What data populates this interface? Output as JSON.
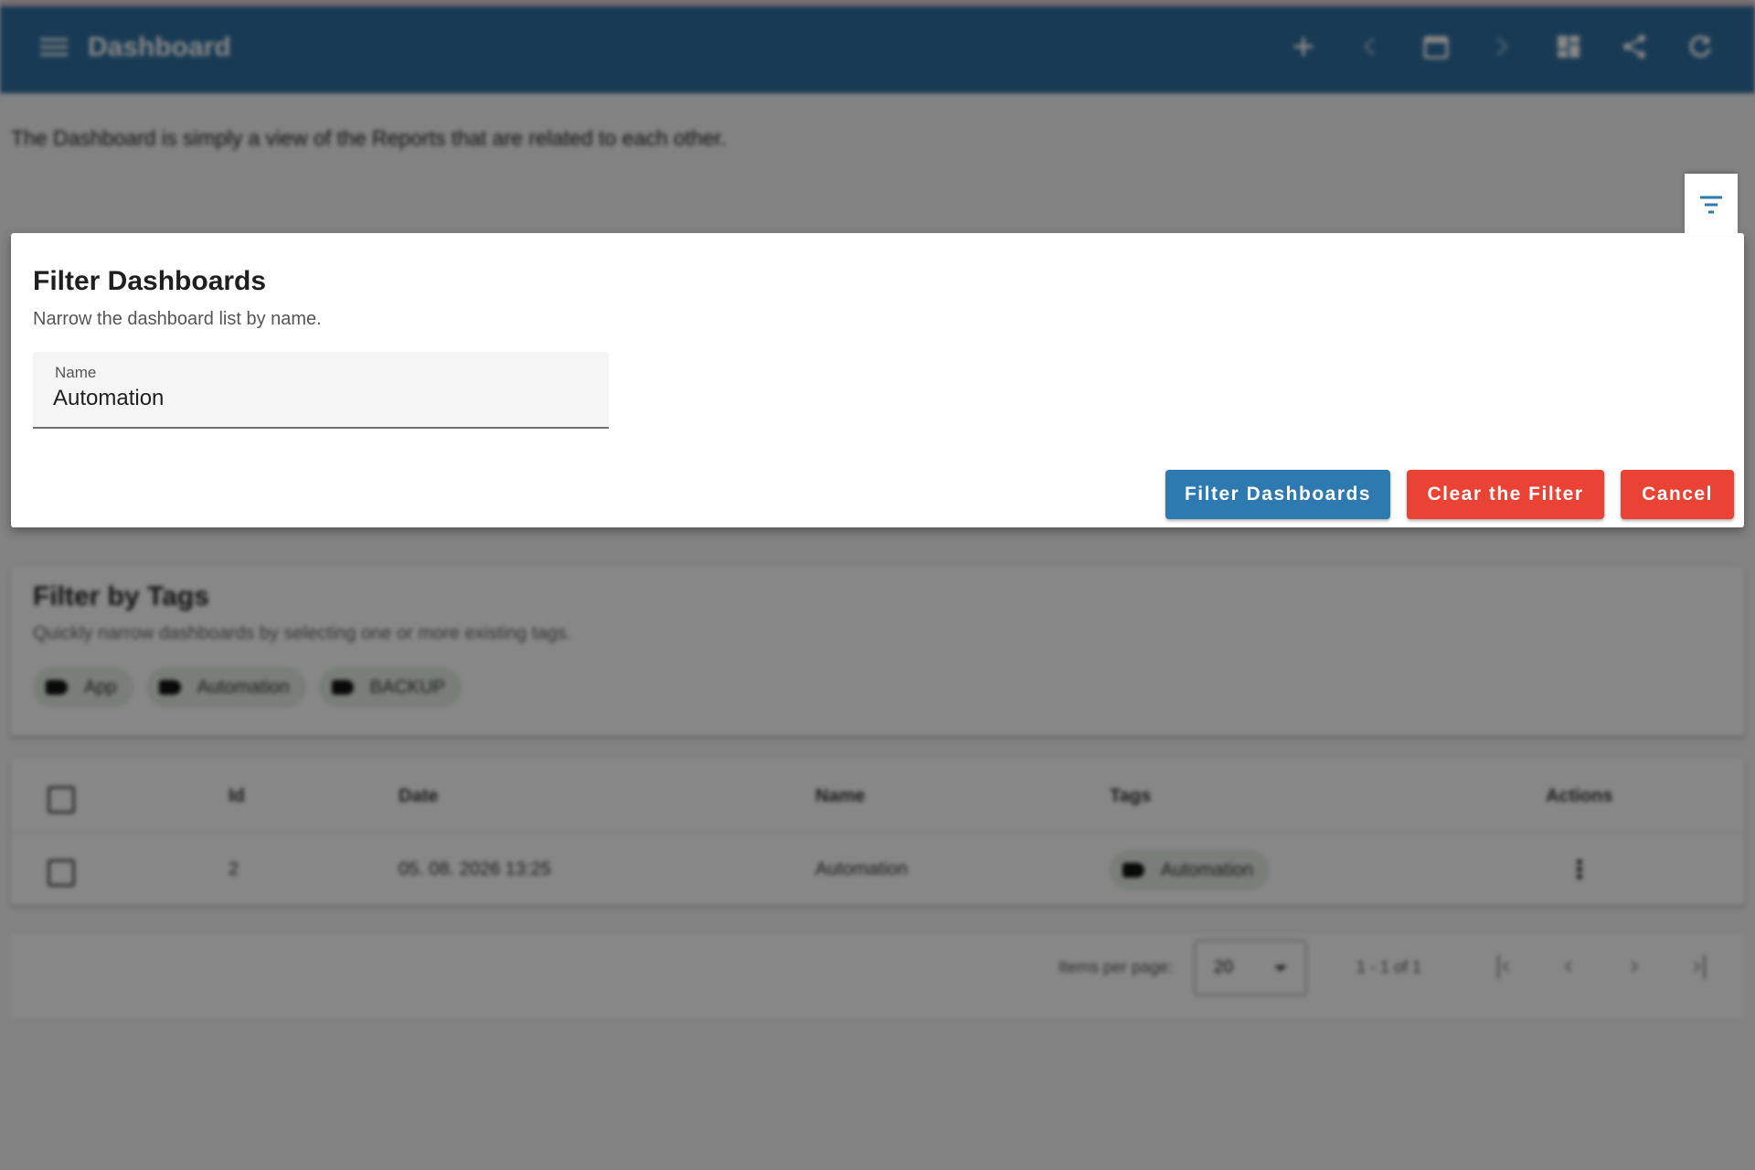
{
  "app": {
    "title": "Dashboard",
    "intro": "The Dashboard is simply a view of the Reports that are related to each other.",
    "colors": {
      "toolbar": "#2f6f9f",
      "primary": "#2f79b1",
      "warn": "#ea4335"
    },
    "toolbar_icons": [
      "add-icon",
      "chevron-left-icon",
      "calendar-icon",
      "chevron-right-icon",
      "dashboard-grid-icon",
      "share-icon",
      "refresh-icon"
    ]
  },
  "tags_filter": {
    "title": "Filter by Tags",
    "subtitle": "Quickly narrow dashboards by selecting one or more existing tags.",
    "tags": [
      "App",
      "Automation",
      "BACKUP"
    ]
  },
  "table": {
    "headers": {
      "id": "Id",
      "date": "Date",
      "name": "Name",
      "tags": "Tags",
      "actions": "Actions"
    },
    "rows": [
      {
        "id": "2",
        "date": "05. 08. 2026 13:25",
        "name": "Automation",
        "tag": "Automation"
      }
    ]
  },
  "paginator": {
    "items_per_page_label": "Items per page:",
    "items_per_page": "20",
    "range": "1 - 1 of 1"
  },
  "dialog": {
    "title": "Filter Dashboards",
    "subtitle": "Narrow the dashboard list by name.",
    "field_label": "Name",
    "field_value": "Automation",
    "buttons": {
      "filter": "Filter Dashboards",
      "clear": "Clear the Filter",
      "cancel": "Cancel"
    }
  }
}
